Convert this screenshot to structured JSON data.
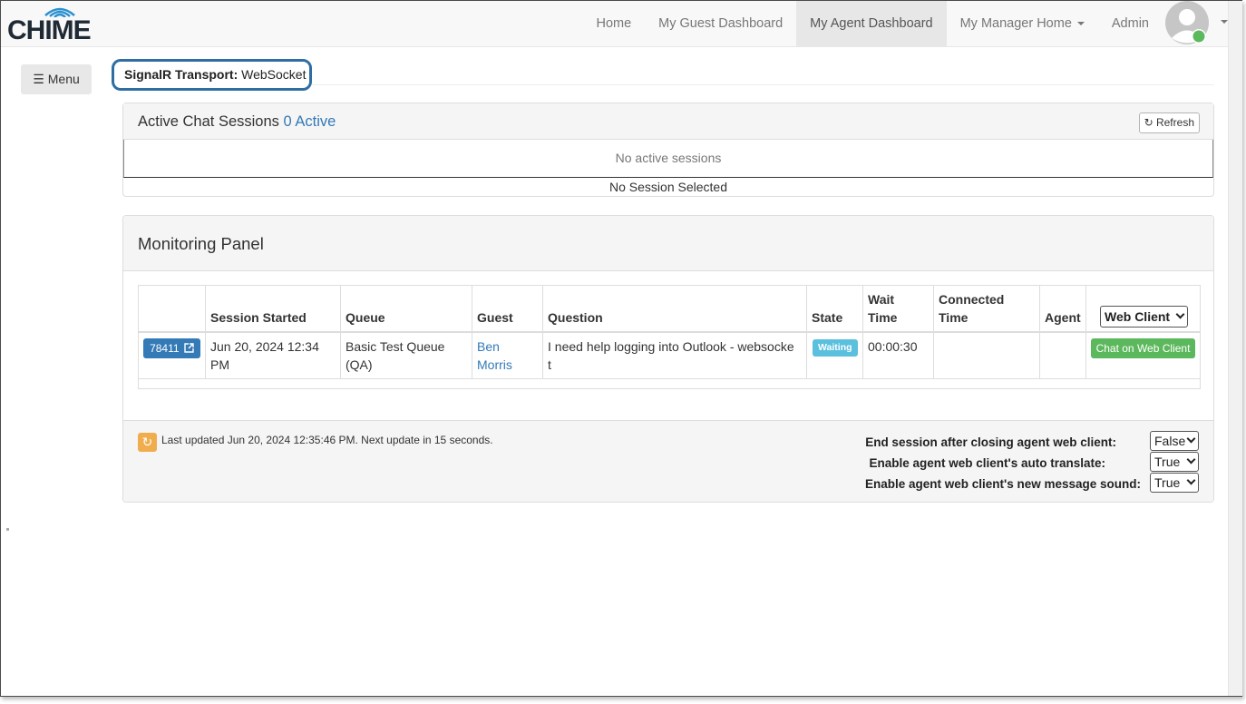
{
  "brand": {
    "logo_text": "CHIME"
  },
  "nav": {
    "items": [
      {
        "label": "Home",
        "active": false
      },
      {
        "label": "My Guest Dashboard",
        "active": false
      },
      {
        "label": "My Agent Dashboard",
        "active": true
      },
      {
        "label": "My Manager Home",
        "active": false,
        "dropdown": true
      },
      {
        "label": "Admin",
        "active": false
      }
    ],
    "avatar_status_color": "#5cb85c"
  },
  "sidebar": {
    "menu_label": "Menu"
  },
  "signalr": {
    "label": "SignalR Transport:",
    "value": "WebSocket"
  },
  "active_sessions": {
    "title": "Active Chat Sessions",
    "count_label": "0 Active",
    "refresh_label": "Refresh",
    "empty_message": "No active sessions",
    "selection_message": "No Session Selected"
  },
  "monitoring": {
    "title": "Monitoring Panel",
    "columns": {
      "session_started": "Session Started",
      "queue": "Queue",
      "guest": "Guest",
      "question": "Question",
      "state": "State",
      "wait_time_1": "Wait",
      "wait_time_2": "Time",
      "connected_1": "Connected",
      "connected_2": "Time",
      "agent": "Agent",
      "web_client_select": "Web Client"
    },
    "rows": [
      {
        "id": "78411",
        "started_1": "Jun 20, 2024 12:34",
        "started_2": "PM",
        "queue_1": "Basic Test Queue",
        "queue_2": "(QA)",
        "guest_1": "Ben",
        "guest_2": "Morris",
        "question_1": "I need help logging into Outlook - websocke",
        "question_2": "t",
        "state": "Waiting",
        "wait_time": "00:00:30",
        "connected_time": "",
        "agent": "",
        "action": "Chat on Web Client"
      }
    ],
    "footer": {
      "last_updated": "Last updated Jun 20, 2024 12:35:46 PM. Next update in 15 seconds.",
      "options": [
        {
          "label": "End session after closing agent web client:",
          "value": "False"
        },
        {
          "label": "Enable agent web client's auto translate:",
          "value": "True"
        },
        {
          "label": "Enable agent web client's new message sound:",
          "value": "True"
        }
      ]
    }
  },
  "colors": {
    "primary": "#337ab7",
    "success": "#5cb85c",
    "info": "#5bc0de",
    "warning": "#f0ad4e",
    "highlight_border": "#2f6ea3"
  }
}
